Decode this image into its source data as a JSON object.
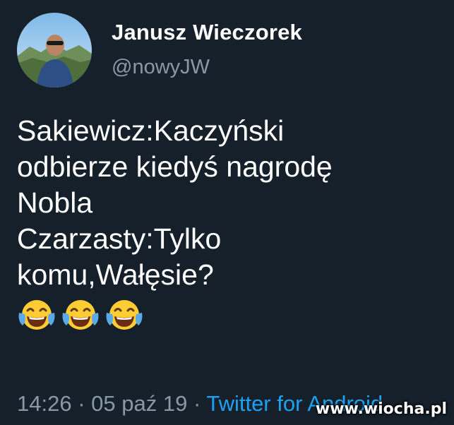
{
  "user": {
    "display_name": "Janusz Wieczorek",
    "handle": "@nowyJW"
  },
  "tweet": {
    "lines": [
      "Sakiewicz:Kaczyński",
      "odbierze kiedyś nagrodę",
      "Nobla",
      "Czarzasty:Tylko",
      "komu,Wałęsie?"
    ],
    "emoji_count": 3,
    "emoji_name": "face-with-tears-of-joy-icon"
  },
  "meta": {
    "time": "14:26",
    "separator": "·",
    "date": "05 paź 19",
    "source": "Twitter for Android"
  },
  "watermark": "www.wiocha.pl",
  "colors": {
    "background": "#15202b",
    "text": "#ffffff",
    "secondary": "#8899a6",
    "link": "#1da1f2"
  }
}
